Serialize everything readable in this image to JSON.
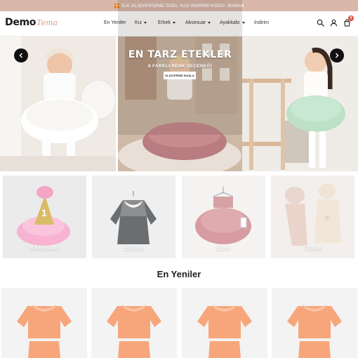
{
  "announcement": {
    "text": "İLK ALIŞVERİŞİNE ÖZEL %10 İNDİRİM KODU: BNM10"
  },
  "logo": {
    "main": "Demo",
    "script": "Tema"
  },
  "nav": [
    {
      "label": "En Yeniler",
      "has_dropdown": false
    },
    {
      "label": "Kız",
      "has_dropdown": true
    },
    {
      "label": "Erkek",
      "has_dropdown": true
    },
    {
      "label": "Aksesuar",
      "has_dropdown": true
    },
    {
      "label": "Ayakkabı",
      "has_dropdown": true
    },
    {
      "label": "İndirim",
      "has_dropdown": false
    }
  ],
  "header_icons": [
    "search-icon",
    "user-icon",
    "cart-icon"
  ],
  "cart": {
    "count": "0"
  },
  "hero": {
    "title": "EN TARZ ETEKLER",
    "subtitle": "8 FARKLI RENK SEÇENEĞİ",
    "button": "ALIŞVERİŞE BAŞLA"
  },
  "categories": [
    {
      "label": "Aksesuar"
    },
    {
      "label": "Elbise"
    },
    {
      "label": "Etek"
    },
    {
      "label": "Tulum"
    }
  ],
  "section": {
    "title": "En Yeniler"
  },
  "colors": {
    "announcement_bg": "#d9b8aa",
    "badge": "#e0533c",
    "accent_script": "#d2a08c",
    "product_peach": "#f7a67c"
  }
}
